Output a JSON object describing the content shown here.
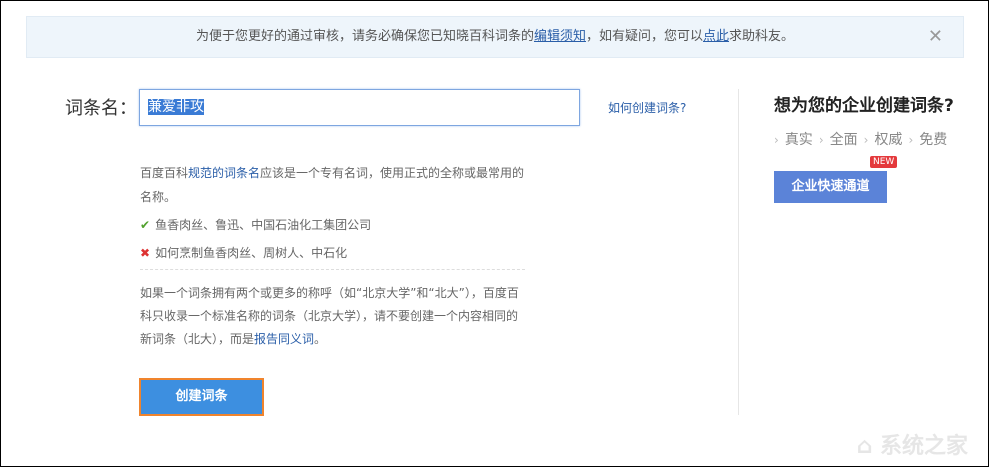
{
  "notice": {
    "text_before": "为便于您更好的通过审核，请务必确保您已知晓百科词条的",
    "link1": "编辑须知",
    "text_mid": "，如有疑问，您可以",
    "link2": "点此",
    "text_after": "求助科友。",
    "close": "✕"
  },
  "form": {
    "label": "词条名：",
    "value": "兼爱非攻",
    "howto_link": "如何创建词条?"
  },
  "desc": {
    "p1_before": "百度百科",
    "p1_link": "规范的词条名",
    "p1_after": "应该是一个专有名词，使用正式的全称或最常用的名称。",
    "good": "鱼香肉丝、鲁迅、中国石油化工集团公司",
    "bad": "如何烹制鱼香肉丝、周树人、中石化",
    "p2": "如果一个词条拥有两个或更多的称呼（如“北京大学”和“北大”），百度百科只收录一个标准名称的词条（北京大学），请不要创建一个内容相同的新词条（北大），而是",
    "p2_link": "报告同义词",
    "p2_end": "。"
  },
  "create_button": "创建词条",
  "side": {
    "heading": "想为您的企业创建词条?",
    "features": [
      "真实",
      "全面",
      "权威",
      "免费"
    ],
    "badge": "NEW",
    "button": "企业快速通道"
  },
  "watermark": "系统之家"
}
